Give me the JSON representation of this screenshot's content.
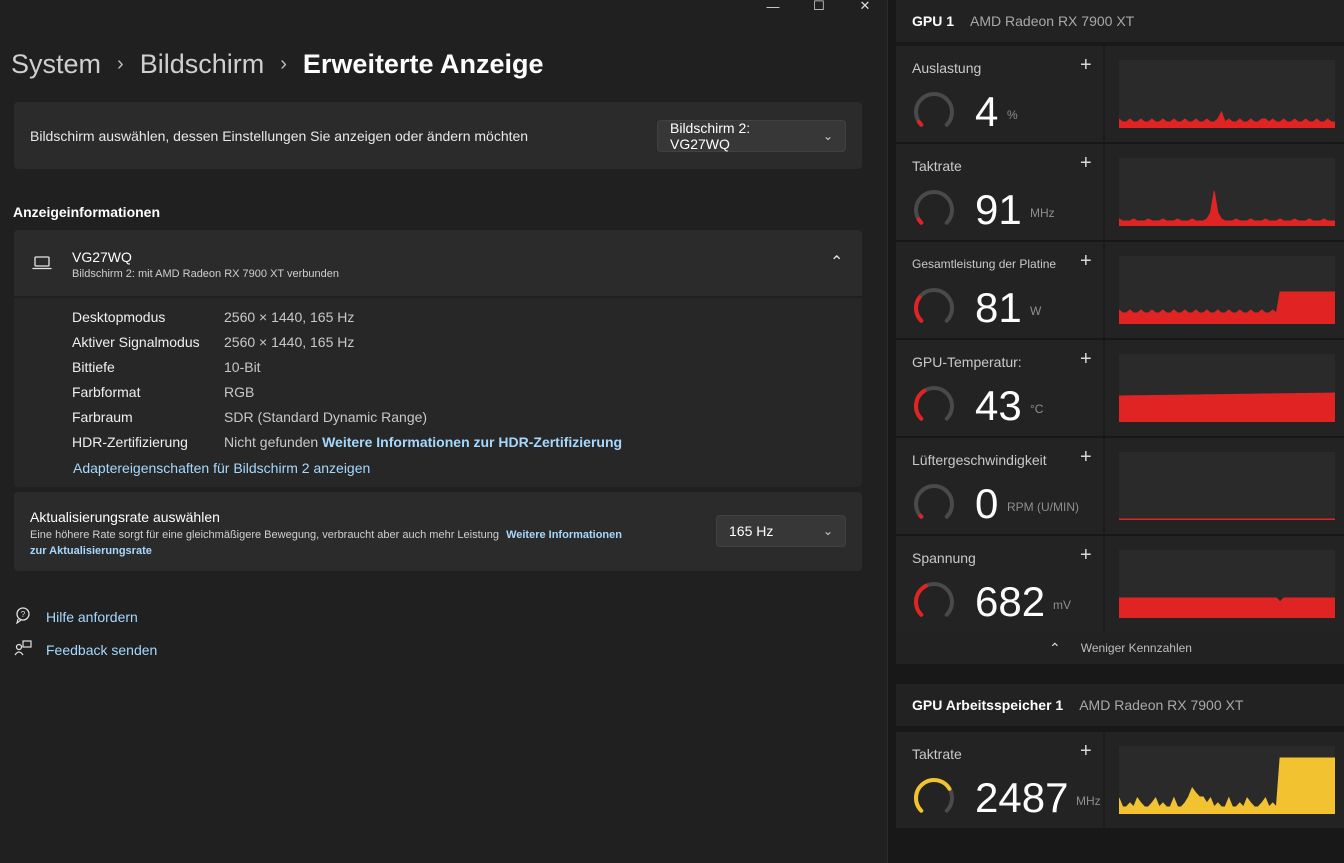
{
  "window": {
    "controls": [
      "—",
      "☐",
      "✕"
    ]
  },
  "breadcrumb": {
    "items": [
      "System",
      "Bildschirm",
      "Erweiterte Anzeige"
    ],
    "sep": "›"
  },
  "select_display": {
    "label": "Bildschirm auswählen, dessen Einstellungen Sie anzeigen oder ändern möchten",
    "value": "Bildschirm 2: VG27WQ"
  },
  "display_info": {
    "section_title": "Anzeigeinformationen",
    "name": "VG27WQ",
    "subtitle": "Bildschirm 2: mit AMD Radeon RX 7900 XT verbunden",
    "rows": [
      {
        "key": "Desktopmodus",
        "value": "2560 × 1440, 165 Hz"
      },
      {
        "key": "Aktiver Signalmodus",
        "value": "2560 × 1440, 165 Hz"
      },
      {
        "key": "Bittiefe",
        "value": "10-Bit"
      },
      {
        "key": "Farbformat",
        "value": "RGB"
      },
      {
        "key": "Farbraum",
        "value": "SDR (Standard Dynamic Range)"
      },
      {
        "key": "HDR-Zertifizierung",
        "value": "Nicht gefunden",
        "link": "Weitere Informationen zur HDR-Zertifizierung"
      }
    ],
    "adapter_link": "Adaptereigenschaften für Bildschirm 2 anzeigen"
  },
  "refresh": {
    "title": "Aktualisierungsrate auswählen",
    "desc": "Eine höhere Rate sorgt für eine gleichmäßigere Bewegung, verbraucht aber auch mehr Leistung",
    "link_1": "Weitere Informationen",
    "link_2": "zur Aktualisierungsrate",
    "value": "165 Hz"
  },
  "footer": {
    "help": "Hilfe anfordern",
    "feedback": "Feedback senden"
  },
  "gpu": {
    "title": "GPU 1",
    "name": "AMD Radeon RX 7900 XT",
    "metrics": [
      {
        "title": "Auslastung",
        "value": "4",
        "unit": "%",
        "level": 0.04,
        "color": "#e02424"
      },
      {
        "title": "Taktrate",
        "value": "91",
        "unit": "MHz",
        "level": 0.05,
        "color": "#e02424"
      },
      {
        "title": "Gesamtleistung der Platine",
        "value": "81",
        "unit": "W",
        "level": 0.3,
        "color": "#e02424"
      },
      {
        "title": "GPU-Temperatur:",
        "value": "43",
        "unit": "°C",
        "level": 0.38,
        "color": "#e02424"
      },
      {
        "title": "Lüftergeschwindigkeit",
        "value": "0",
        "unit": "RPM (U/MIN)",
        "level": 0.0,
        "color": "#e02424"
      },
      {
        "title": "Spannung",
        "value": "682",
        "unit": "mV",
        "level": 0.4,
        "color": "#e02424"
      }
    ],
    "less_label": "Weniger Kennzahlen"
  },
  "gpu_mem": {
    "title": "GPU Arbeitsspeicher 1",
    "name": "AMD Radeon RX 7900 XT",
    "metric": {
      "title": "Taktrate",
      "value": "2487",
      "unit": "MHz",
      "level": 0.72,
      "color": "#f2c230"
    }
  },
  "icons": {
    "plus": "+",
    "chevron_down": "⌄",
    "chevron_up": "⌃",
    "laptop": "laptop-icon",
    "help": "help-icon",
    "feedback": "feedback-icon"
  }
}
